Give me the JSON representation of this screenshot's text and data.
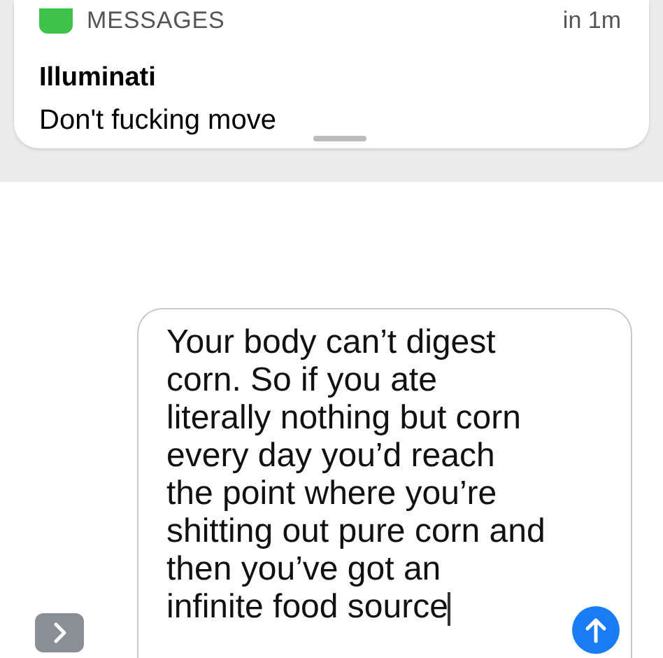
{
  "notification": {
    "app": "MESSAGES",
    "time": "in 1m",
    "title": "Illuminati",
    "body": "Don't fucking move"
  },
  "compose": {
    "text": "Your body can’t digest corn. So if you ate literally nothing but corn every day you’d reach the point where you’re shitting out pure corn and then you’ve got an infinite food source"
  }
}
